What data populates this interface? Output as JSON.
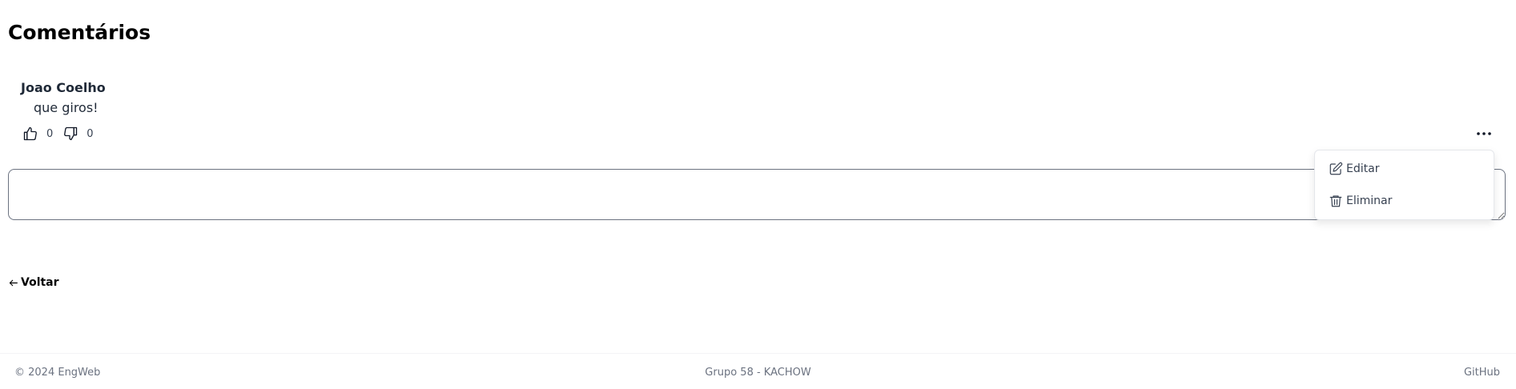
{
  "comments_section": {
    "title": "Comentários",
    "comment": {
      "author": "Joao Coelho",
      "text": "que giros!",
      "likes": "0",
      "dislikes": "0",
      "like_icon": "thumbs-up-icon",
      "dislike_icon": "thumbs-down-icon",
      "more_icon": "ellipsis-icon"
    },
    "input": {
      "value": "",
      "placeholder": ""
    }
  },
  "dropdown_menu": {
    "items": [
      {
        "label": "Editar",
        "icon": "edit-icon"
      },
      {
        "label": "Eliminar",
        "icon": "trash-icon"
      }
    ]
  },
  "back_link": {
    "label": "Voltar",
    "icon": "arrow-left-icon"
  },
  "footer": {
    "copyright": "© 2024 EngWeb",
    "center": "Grupo 58 - KACHOW",
    "github": "GitHub"
  },
  "colors": {
    "text": "#111827",
    "muted": "#6b7280",
    "border": "#6b7280"
  }
}
